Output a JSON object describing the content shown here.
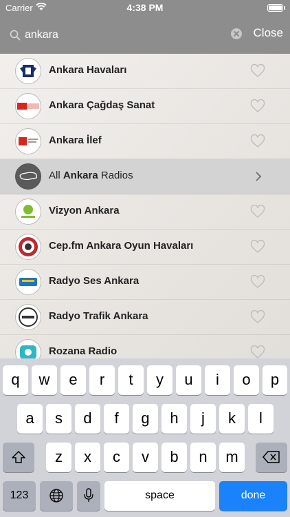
{
  "status_bar": {
    "carrier": "Carrier",
    "time": "4:38 PM"
  },
  "search": {
    "value": "ankara",
    "close_label": "Close"
  },
  "results": [
    {
      "label": "Ankara Havaları",
      "logo": "radio-logo-havalari"
    },
    {
      "label": "Ankara Çağdaş Sanat",
      "logo": "radio-logo-cagdas"
    },
    {
      "label": "Ankara İlef",
      "logo": "radio-logo-ilef"
    },
    {
      "label_prefix": "All ",
      "label_bold": "Ankara",
      "label_suffix": " Radios",
      "logo": "map-icon",
      "highlight": true
    },
    {
      "label": "Vizyon Ankara",
      "logo": "radio-logo-vizyon"
    },
    {
      "label": "Cep.fm Ankara Oyun Havaları",
      "logo": "radio-logo-cepfm"
    },
    {
      "label": "Radyo Ses Ankara",
      "logo": "radio-logo-ses"
    },
    {
      "label": "Radyo Trafik Ankara",
      "logo": "radio-logo-trafik"
    },
    {
      "label": "Rozana Radio",
      "logo": "radio-logo-rozana"
    }
  ],
  "keyboard": {
    "row1": [
      "q",
      "w",
      "e",
      "r",
      "t",
      "y",
      "u",
      "i",
      "o",
      "p"
    ],
    "row2": [
      "a",
      "s",
      "d",
      "f",
      "g",
      "h",
      "j",
      "k",
      "l"
    ],
    "row3": [
      "z",
      "x",
      "c",
      "v",
      "b",
      "n",
      "m"
    ],
    "numbers_label": "123",
    "space_label": "space",
    "return_label": "done"
  },
  "colors": {
    "accent": "#1a82fb",
    "header": "#8d8d8d",
    "keyboard_bg": "#d1d3d9"
  }
}
